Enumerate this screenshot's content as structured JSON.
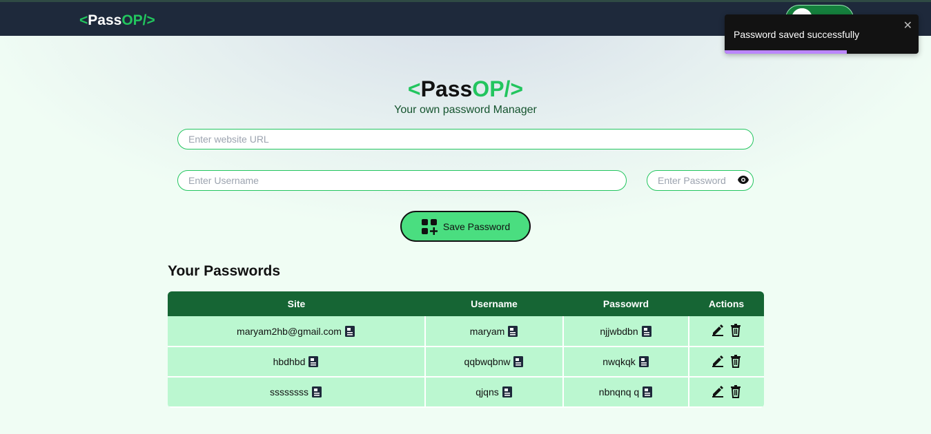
{
  "nav": {
    "logo_lt": "<",
    "logo_pass": "Pass",
    "logo_op": "OP/>"
  },
  "toast": {
    "message": "Password saved successfully",
    "close": "✕",
    "progress_percent": 63
  },
  "header": {
    "title_lt": "<",
    "title_pass": "Pass",
    "title_op": "OP/>",
    "subtitle": "Your own password Manager"
  },
  "form": {
    "url_placeholder": "Enter website URL",
    "username_placeholder": "Enter Username",
    "password_placeholder": "Enter Password",
    "save_label": "Save Password"
  },
  "passwords": {
    "title": "Your Passwords",
    "columns": [
      "Site",
      "Username",
      "Passowrd",
      "Actions"
    ],
    "rows": [
      {
        "site": "maryam2hb@gmail.com",
        "username": "maryam",
        "password": "njjwbdbn"
      },
      {
        "site": "hbdhbd",
        "username": "qqbwqbnw",
        "password": "nwqkqk"
      },
      {
        "site": "ssssssss",
        "username": "qjqns",
        "password": "nbnqnq q"
      }
    ]
  },
  "colors": {
    "navbar": "#1e293b",
    "accent_green": "#22c55e",
    "table_header": "#166534",
    "table_row": "#bbf7d0",
    "button": "#4ade80"
  }
}
